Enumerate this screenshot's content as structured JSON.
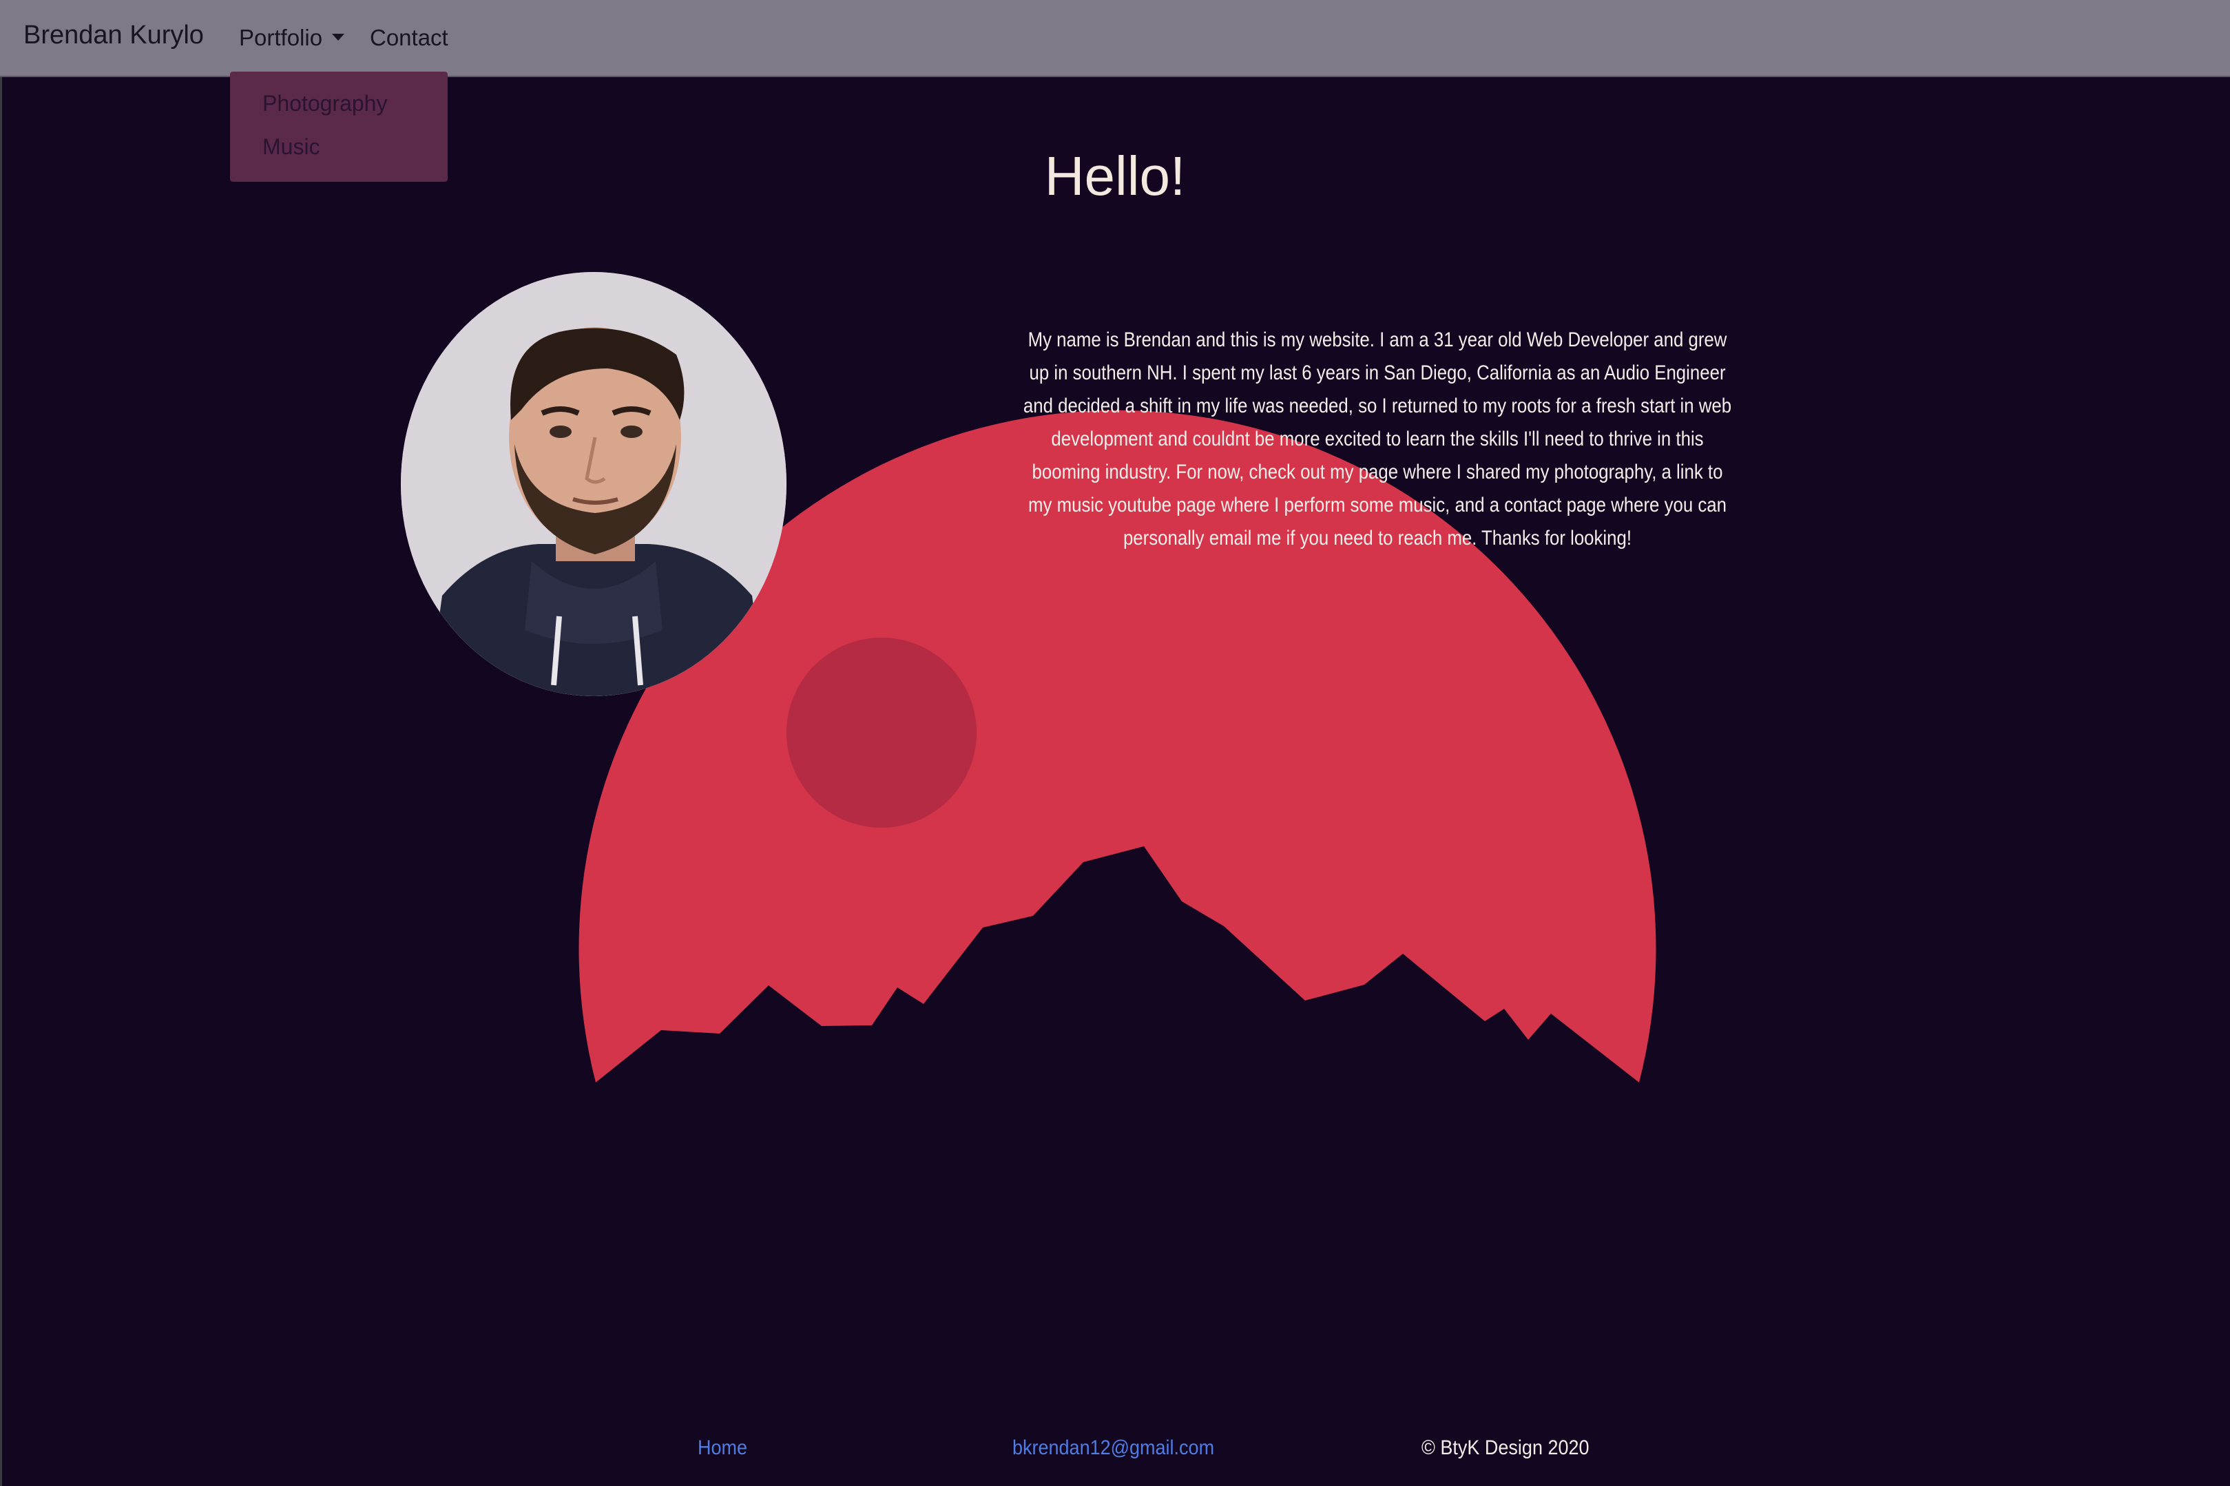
{
  "navbar": {
    "brand": "Brendan Kurylo",
    "portfolio_label": "Portfolio",
    "contact_label": "Contact",
    "dropdown": {
      "items": [
        {
          "label": "Photography"
        },
        {
          "label": "Music"
        }
      ]
    }
  },
  "main": {
    "heading": "Hello!",
    "bio": "My name is Brendan and this is my website. I am a 31 year old Web Developer and grew up in southern NH. I spent my last 6 years in San Diego, California as an Audio Engineer and decided a shift in my life was needed, so I returned to my roots for a fresh start in web development and couldnt be more excited to learn the skills I'll need to thrive in this booming industry. For now, check out my page where I shared my photography, a link to my music youtube page where I perform some music, and a contact page where you can personally email me if you need to reach me. Thanks for looking!"
  },
  "footer": {
    "home_label": "Home",
    "email": "bkrendan12@gmail.com",
    "copyright": "© BtyK Design 2020"
  },
  "colors": {
    "background": "#130620",
    "navbar": "#7f7a87",
    "dropdown": "#5b2a4a",
    "moon": "#d4354b",
    "small_moon": "#b52b43",
    "link": "#4f7de6"
  },
  "icons": {
    "caret": "chevron-down-icon"
  }
}
